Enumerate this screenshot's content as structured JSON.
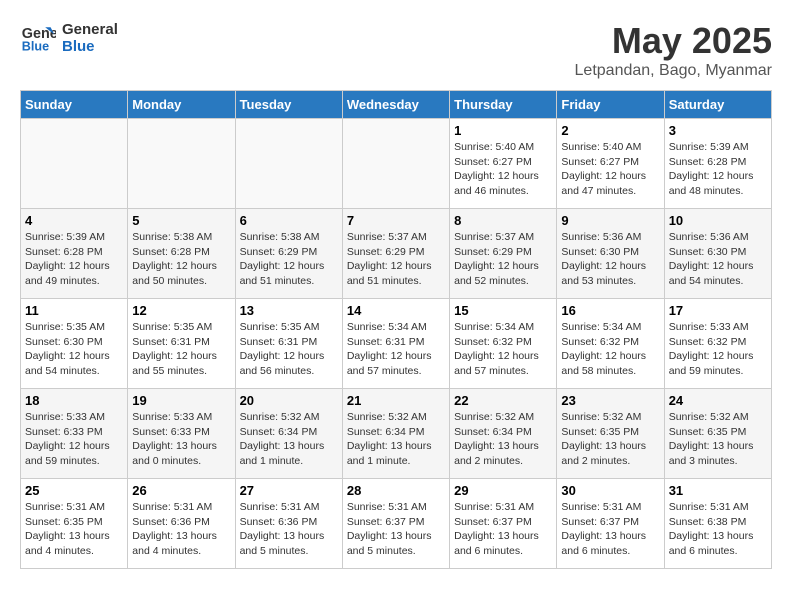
{
  "header": {
    "logo_line1": "General",
    "logo_line2": "Blue",
    "title": "May 2025",
    "subtitle": "Letpandan, Bago, Myanmar"
  },
  "days_of_week": [
    "Sunday",
    "Monday",
    "Tuesday",
    "Wednesday",
    "Thursday",
    "Friday",
    "Saturday"
  ],
  "weeks": [
    [
      {
        "day": "",
        "info": ""
      },
      {
        "day": "",
        "info": ""
      },
      {
        "day": "",
        "info": ""
      },
      {
        "day": "",
        "info": ""
      },
      {
        "day": "1",
        "info": "Sunrise: 5:40 AM\nSunset: 6:27 PM\nDaylight: 12 hours\nand 46 minutes."
      },
      {
        "day": "2",
        "info": "Sunrise: 5:40 AM\nSunset: 6:27 PM\nDaylight: 12 hours\nand 47 minutes."
      },
      {
        "day": "3",
        "info": "Sunrise: 5:39 AM\nSunset: 6:28 PM\nDaylight: 12 hours\nand 48 minutes."
      }
    ],
    [
      {
        "day": "4",
        "info": "Sunrise: 5:39 AM\nSunset: 6:28 PM\nDaylight: 12 hours\nand 49 minutes."
      },
      {
        "day": "5",
        "info": "Sunrise: 5:38 AM\nSunset: 6:28 PM\nDaylight: 12 hours\nand 50 minutes."
      },
      {
        "day": "6",
        "info": "Sunrise: 5:38 AM\nSunset: 6:29 PM\nDaylight: 12 hours\nand 51 minutes."
      },
      {
        "day": "7",
        "info": "Sunrise: 5:37 AM\nSunset: 6:29 PM\nDaylight: 12 hours\nand 51 minutes."
      },
      {
        "day": "8",
        "info": "Sunrise: 5:37 AM\nSunset: 6:29 PM\nDaylight: 12 hours\nand 52 minutes."
      },
      {
        "day": "9",
        "info": "Sunrise: 5:36 AM\nSunset: 6:30 PM\nDaylight: 12 hours\nand 53 minutes."
      },
      {
        "day": "10",
        "info": "Sunrise: 5:36 AM\nSunset: 6:30 PM\nDaylight: 12 hours\nand 54 minutes."
      }
    ],
    [
      {
        "day": "11",
        "info": "Sunrise: 5:35 AM\nSunset: 6:30 PM\nDaylight: 12 hours\nand 54 minutes."
      },
      {
        "day": "12",
        "info": "Sunrise: 5:35 AM\nSunset: 6:31 PM\nDaylight: 12 hours\nand 55 minutes."
      },
      {
        "day": "13",
        "info": "Sunrise: 5:35 AM\nSunset: 6:31 PM\nDaylight: 12 hours\nand 56 minutes."
      },
      {
        "day": "14",
        "info": "Sunrise: 5:34 AM\nSunset: 6:31 PM\nDaylight: 12 hours\nand 57 minutes."
      },
      {
        "day": "15",
        "info": "Sunrise: 5:34 AM\nSunset: 6:32 PM\nDaylight: 12 hours\nand 57 minutes."
      },
      {
        "day": "16",
        "info": "Sunrise: 5:34 AM\nSunset: 6:32 PM\nDaylight: 12 hours\nand 58 minutes."
      },
      {
        "day": "17",
        "info": "Sunrise: 5:33 AM\nSunset: 6:32 PM\nDaylight: 12 hours\nand 59 minutes."
      }
    ],
    [
      {
        "day": "18",
        "info": "Sunrise: 5:33 AM\nSunset: 6:33 PM\nDaylight: 12 hours\nand 59 minutes."
      },
      {
        "day": "19",
        "info": "Sunrise: 5:33 AM\nSunset: 6:33 PM\nDaylight: 13 hours\nand 0 minutes."
      },
      {
        "day": "20",
        "info": "Sunrise: 5:32 AM\nSunset: 6:34 PM\nDaylight: 13 hours\nand 1 minute."
      },
      {
        "day": "21",
        "info": "Sunrise: 5:32 AM\nSunset: 6:34 PM\nDaylight: 13 hours\nand 1 minute."
      },
      {
        "day": "22",
        "info": "Sunrise: 5:32 AM\nSunset: 6:34 PM\nDaylight: 13 hours\nand 2 minutes."
      },
      {
        "day": "23",
        "info": "Sunrise: 5:32 AM\nSunset: 6:35 PM\nDaylight: 13 hours\nand 2 minutes."
      },
      {
        "day": "24",
        "info": "Sunrise: 5:32 AM\nSunset: 6:35 PM\nDaylight: 13 hours\nand 3 minutes."
      }
    ],
    [
      {
        "day": "25",
        "info": "Sunrise: 5:31 AM\nSunset: 6:35 PM\nDaylight: 13 hours\nand 4 minutes."
      },
      {
        "day": "26",
        "info": "Sunrise: 5:31 AM\nSunset: 6:36 PM\nDaylight: 13 hours\nand 4 minutes."
      },
      {
        "day": "27",
        "info": "Sunrise: 5:31 AM\nSunset: 6:36 PM\nDaylight: 13 hours\nand 5 minutes."
      },
      {
        "day": "28",
        "info": "Sunrise: 5:31 AM\nSunset: 6:37 PM\nDaylight: 13 hours\nand 5 minutes."
      },
      {
        "day": "29",
        "info": "Sunrise: 5:31 AM\nSunset: 6:37 PM\nDaylight: 13 hours\nand 6 minutes."
      },
      {
        "day": "30",
        "info": "Sunrise: 5:31 AM\nSunset: 6:37 PM\nDaylight: 13 hours\nand 6 minutes."
      },
      {
        "day": "31",
        "info": "Sunrise: 5:31 AM\nSunset: 6:38 PM\nDaylight: 13 hours\nand 6 minutes."
      }
    ]
  ]
}
